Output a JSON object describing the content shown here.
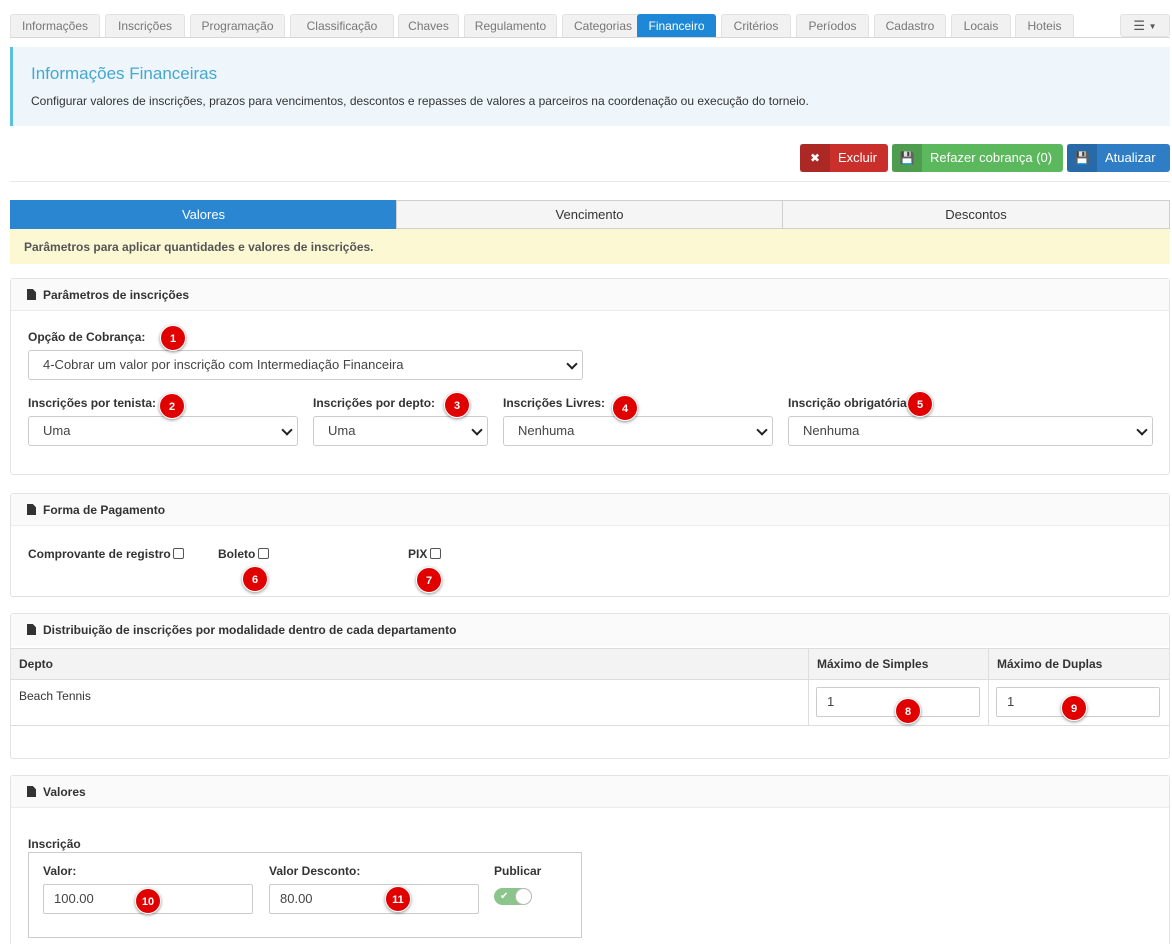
{
  "top_tabs": [
    "Informações",
    "Inscrições",
    "Programação",
    "Classificação",
    "Chaves",
    "Regulamento",
    "Categorias",
    "Financeiro",
    "Critérios",
    "Períodos",
    "Cadastro",
    "Locais",
    "Hoteis"
  ],
  "top_tabs_active": "Financeiro",
  "menu_icon": "hamburger-caret-icon",
  "header": {
    "title": "Informações Financeiras",
    "description": "Configurar valores de inscrições, prazos para vencimentos, descontos e repasses de valores a parceiros na coordenação ou execução do torneio."
  },
  "actions": {
    "delete_label": "Excluir",
    "recharge_label": "Refazer cobrança (0)",
    "update_label": "Atualizar"
  },
  "sub_tabs": [
    "Valores",
    "Vencimento",
    "Descontos"
  ],
  "sub_tabs_active": "Valores",
  "warning": "Parâmetros para aplicar quantidades e valores de inscrições.",
  "params": {
    "title": "Parâmetros de inscrições",
    "charge_option_label": "Opção de Cobrança:",
    "charge_option_value": "4-Cobrar um valor por inscrição com Intermediação Financeira",
    "per_player_label": "Inscrições por tenista:",
    "per_player_value": "Uma",
    "per_dept_label": "Inscrições por depto:",
    "per_dept_value": "Uma",
    "free_label": "Inscrições Livres:",
    "free_value": "Nenhuma",
    "mandatory_label": "Inscrição obrigatória:",
    "mandatory_value": "Nenhuma"
  },
  "payment": {
    "title": "Forma de Pagamento",
    "receipt_label": "Comprovante de registro",
    "boleto_label": "Boleto",
    "pix_label": "PIX"
  },
  "distribution": {
    "title": "Distribuição de inscrições por modalidade dentro de cada departamento",
    "col_dept": "Depto",
    "col_singles": "Máximo de Simples",
    "col_doubles": "Máximo de Duplas",
    "row_dept": "Beach Tennis",
    "row_singles": "1",
    "row_doubles": "1"
  },
  "values": {
    "title": "Valores",
    "group_label": "Inscrição",
    "value_label": "Valor:",
    "value": "100.00",
    "discount_label": "Valor Desconto:",
    "discount_value": "80.00",
    "publish_label": "Publicar",
    "publish_enabled": true
  },
  "badges": [
    "1",
    "2",
    "3",
    "4",
    "5",
    "6",
    "7",
    "8",
    "9",
    "10",
    "11"
  ],
  "colors": {
    "active_tab": "#1e88d6",
    "danger": "#c9302c",
    "success": "#5cb85c",
    "primary": "#2e7dc5",
    "callout_title": "#43a7d0",
    "warning_bg": "#fcf8d3",
    "badge": "#e00000"
  }
}
